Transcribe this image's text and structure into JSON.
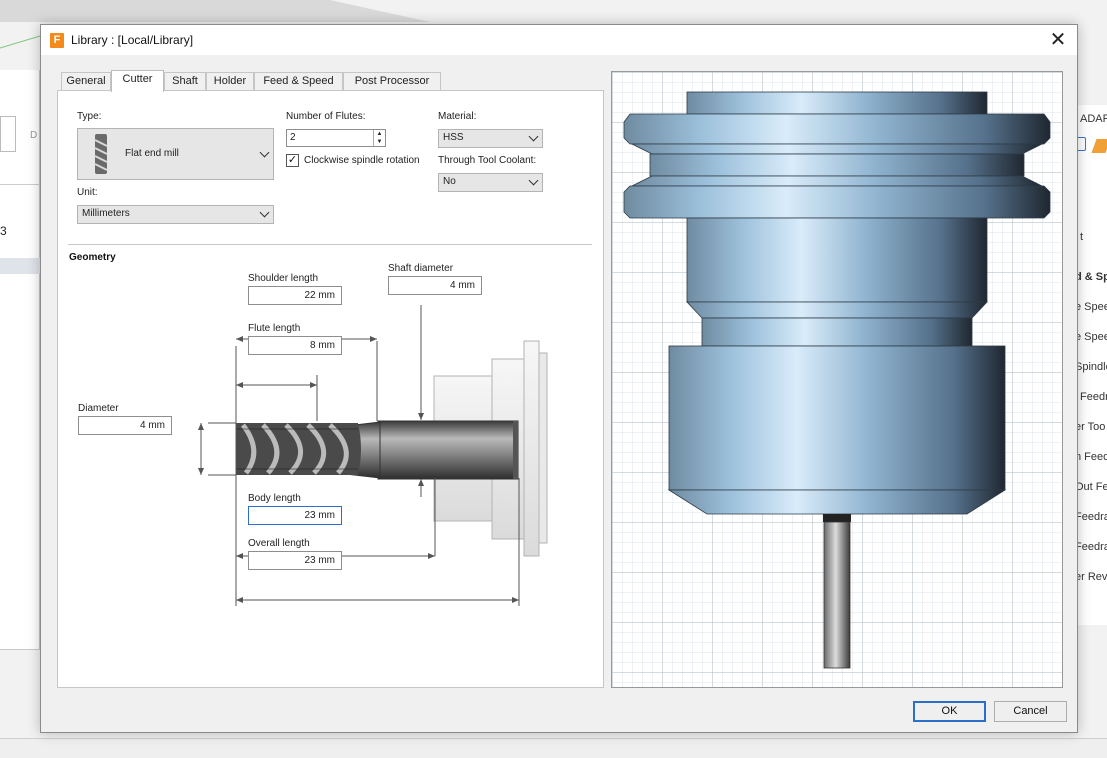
{
  "background": {
    "left_letter": "D",
    "left_number": "3",
    "right_items": [
      "ADAPTI",
      "t",
      "d & Sp",
      "e Spee",
      "e Spee",
      "Spindle",
      "Feedra",
      "er Too",
      "n Feed",
      "Out Fee",
      "Feedra",
      "Feedra",
      "er Rev"
    ]
  },
  "dialog": {
    "app_icon": "F",
    "title": "Library : [Local/Library]",
    "close_glyph": "✕",
    "tabs": [
      "General",
      "Cutter",
      "Shaft",
      "Holder",
      "Feed & Speed",
      "Post Processor"
    ],
    "active_tab": "Cutter",
    "cutter": {
      "type_label": "Type:",
      "type_value": "Flat end mill",
      "unit_label": "Unit:",
      "unit_value": "Millimeters",
      "flutes_label": "Number of Flutes:",
      "flutes_value": "2",
      "clockwise_label": "Clockwise spindle rotation",
      "clockwise_checked": true,
      "material_label": "Material:",
      "material_value": "HSS",
      "coolant_label": "Through Tool Coolant:",
      "coolant_value": "No"
    },
    "geometry": {
      "title": "Geometry",
      "shoulder_length_label": "Shoulder length",
      "shoulder_length_value": "22 mm",
      "shaft_diameter_label": "Shaft diameter",
      "shaft_diameter_value": "4 mm",
      "flute_length_label": "Flute length",
      "flute_length_value": "8 mm",
      "diameter_label": "Diameter",
      "diameter_value": "4 mm",
      "body_length_label": "Body length",
      "body_length_value": "23 mm",
      "overall_length_label": "Overall length",
      "overall_length_value": "23 mm"
    },
    "buttons": {
      "ok": "OK",
      "cancel": "Cancel"
    }
  },
  "colors": {
    "accent": "#2a6fc9",
    "holder_steel": "#8fb3cf",
    "grid": "#c8d4dc"
  }
}
